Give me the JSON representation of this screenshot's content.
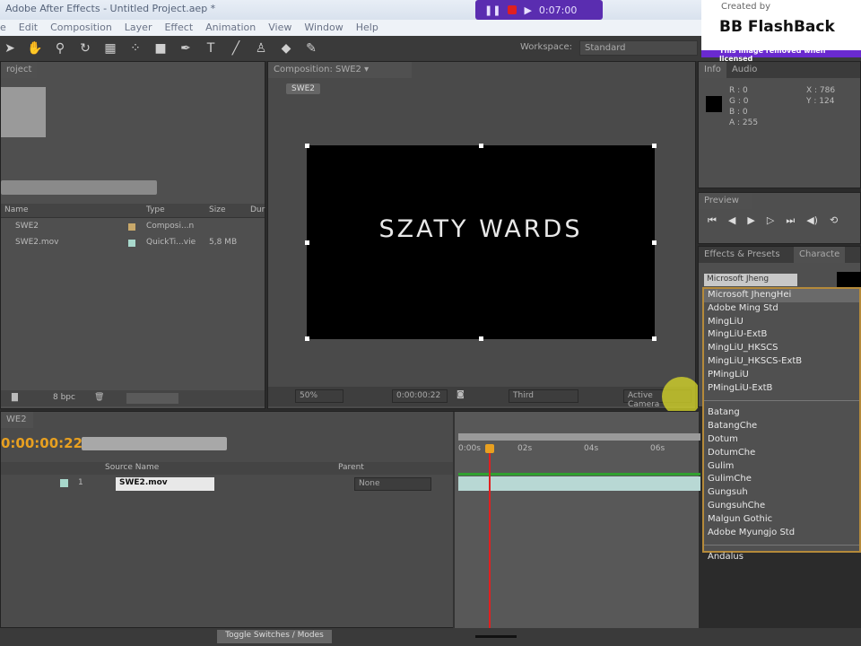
{
  "window": {
    "title": "Adobe After Effects - Untitled Project.aep *"
  },
  "menu": [
    "e",
    "Edit",
    "Composition",
    "Layer",
    "Effect",
    "Animation",
    "View",
    "Window",
    "Help"
  ],
  "recorder": {
    "time": "0:07:00"
  },
  "watermark": {
    "created_by": "Created by",
    "brand": "BB FlashBack",
    "notice": "This image removed when licensed"
  },
  "toolbar": {
    "workspace_label": "Workspace:",
    "workspace_value": "Standard",
    "tools": [
      "selection",
      "hand",
      "zoom",
      "rotate",
      "camera",
      "pan-behind",
      "rectangle",
      "pen",
      "text",
      "brush",
      "clone-stamp",
      "eraser",
      "puppet"
    ]
  },
  "project": {
    "tab": "roject",
    "bpc": "8 bpc",
    "columns": [
      "Name",
      "Type",
      "Size",
      "Dur"
    ],
    "items": [
      {
        "name": "SWE2",
        "type": "Composi...n",
        "size": "",
        "color": "#c8a86a"
      },
      {
        "name": "SWE2.mov",
        "type": "QuickTi...vie",
        "size": "5,8 MB",
        "color": "#a8d8cc"
      }
    ]
  },
  "composition": {
    "tab": "Composition: SWE2",
    "breadcrumb": "SWE2",
    "canvas_text": "SZATY WARDS",
    "zoom": "50%",
    "timecode": "0:00:00:22",
    "resolution": "Third",
    "view": "Active Camera"
  },
  "info": {
    "tabs": [
      "Info",
      "Audio"
    ],
    "r": "R : 0",
    "g": "G : 0",
    "b": "B : 0",
    "a": "A : 255",
    "x": "X : 786",
    "y": "Y : 124"
  },
  "preview": {
    "tab": "Preview"
  },
  "effects": {
    "tabs": [
      "Effects & Presets",
      "Characte"
    ],
    "font_value": "Microsoft Jheng"
  },
  "font_dropdown": {
    "group1": [
      "Microsoft JhengHei",
      "Adobe Ming Std",
      "MingLiU",
      "MingLiU-ExtB",
      "MingLiU_HKSCS",
      "MingLiU_HKSCS-ExtB",
      "PMingLiU",
      "PMingLiU-ExtB"
    ],
    "group2": [
      "Batang",
      "BatangChe",
      "Dotum",
      "DotumChe",
      "Gulim",
      "GulimChe",
      "Gungsuh",
      "GungsuhChe",
      "Malgun Gothic",
      "Adobe Myungjo Std"
    ],
    "group3": [
      "Andalus"
    ]
  },
  "timeline": {
    "tab": "WE2",
    "timecode": "0:00:00:22",
    "columns": {
      "source": "Source Name",
      "parent": "Parent"
    },
    "layer": {
      "index": "1",
      "name": "SWE2.mov",
      "parent": "None"
    },
    "ruler": [
      "0:00s",
      "02s",
      "04s",
      "06s"
    ],
    "toggle": "Toggle Switches / Modes"
  },
  "colors": {
    "timecode": "#e8a020",
    "playhead": "#e02020",
    "layer_bar": "#b8d8d4",
    "work_area": "#30a030"
  }
}
